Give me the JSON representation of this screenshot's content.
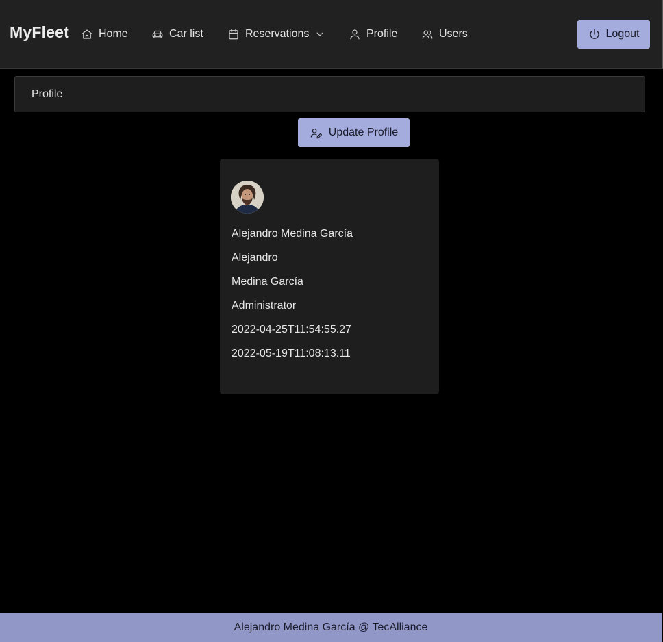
{
  "nav": {
    "brand": "MyFleet",
    "items": [
      {
        "label": "Home",
        "icon": "home-icon"
      },
      {
        "label": "Car list",
        "icon": "car-icon"
      },
      {
        "label": "Reservations",
        "icon": "calendar-icon"
      },
      {
        "label": "Profile",
        "icon": "user-icon"
      },
      {
        "label": "Users",
        "icon": "users-icon"
      }
    ],
    "logout_label": "Logout"
  },
  "breadcrumb": {
    "title": "Profile"
  },
  "update_button": {
    "label": "Update Profile"
  },
  "profile": {
    "full_name": "Alejandro Medina García",
    "first_name": "Alejandro",
    "last_name": "Medina García",
    "role": "Administrator",
    "created_at": "2022-04-25T11:54:55.27",
    "updated_at": "2022-05-19T11:08:13.11"
  },
  "footer": {
    "text": "Alejandro Medina García @ TecAlliance"
  },
  "colors": {
    "background": "#000000",
    "navbar": "#212121",
    "accent_button": "#a3acdc",
    "footer": "#9198c8",
    "card": "#1e1e1e"
  }
}
